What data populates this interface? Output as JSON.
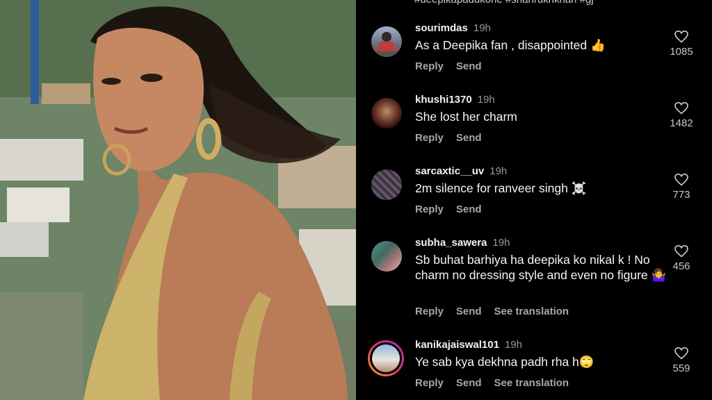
{
  "caption_partial": "#deepikapadukone #shahrukhkhan #gj",
  "photo_alt": "Woman in gold swimsuit with hoop earrings against a hillside",
  "colors": {
    "background": "#000000",
    "text": "#f5f5f5",
    "muted": "#a8a8a8",
    "story_ring": "#e1306c"
  },
  "comments": [
    {
      "user": "sourimdas",
      "time": "19h",
      "text": "As a Deepika fan , disappointed 👍",
      "actions": [
        "Reply",
        "Send"
      ],
      "likes": "1085"
    },
    {
      "user": "khushi1370",
      "time": "19h",
      "text": "She lost her charm",
      "actions": [
        "Reply",
        "Send"
      ],
      "likes": "1482"
    },
    {
      "user": "sarcaxtic__uv",
      "time": "19h",
      "text": "2m silence for ranveer singh ☠️",
      "actions": [
        "Reply",
        "Send"
      ],
      "likes": "773"
    },
    {
      "user": "subha_sawera",
      "time": "19h",
      "text": "Sb buhat barhiya ha deepika ko nikal k ! No charm no dressing style and even no figure 🤷‍♀️",
      "actions": [
        "Reply",
        "Send",
        "See translation"
      ],
      "likes": "456"
    },
    {
      "user": "kanikajaiswal101",
      "time": "19h",
      "text": "Ye sab kya dekhna padh rha h🙄",
      "actions": [
        "Reply",
        "Send",
        "See translation"
      ],
      "likes": "559"
    }
  ]
}
